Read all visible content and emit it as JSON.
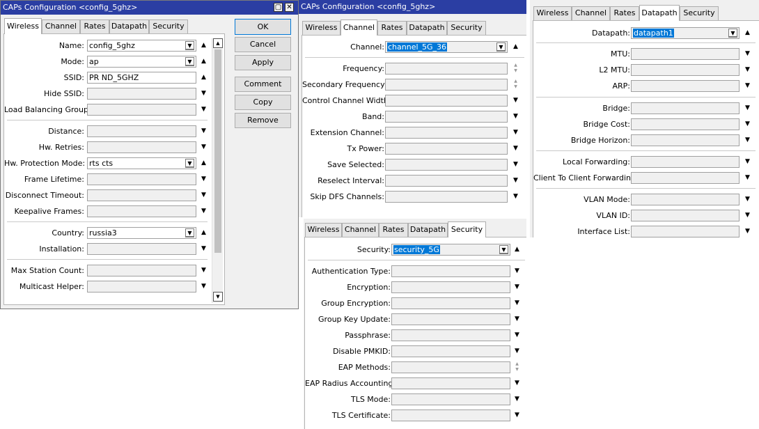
{
  "window1": {
    "title": "CAPs Configuration <config_5ghz>",
    "tabs": [
      "Wireless",
      "Channel",
      "Rates",
      "Datapath",
      "Security"
    ],
    "fields": [
      {
        "label": "Name:",
        "value": "config_5ghz"
      },
      {
        "label": "Mode:",
        "value": "ap"
      },
      {
        "label": "SSID:",
        "value": "PR        ND_5GHZ"
      },
      {
        "label": "Hide SSID:",
        "value": ""
      },
      {
        "label": "Load Balancing Group:",
        "value": ""
      },
      {
        "label": "Distance:",
        "value": ""
      },
      {
        "label": "Hw. Retries:",
        "value": ""
      },
      {
        "label": "Hw. Protection Mode:",
        "value": "rts cts"
      },
      {
        "label": "Frame Lifetime:",
        "value": ""
      },
      {
        "label": "Disconnect Timeout:",
        "value": ""
      },
      {
        "label": "Keepalive Frames:",
        "value": ""
      },
      {
        "label": "Country:",
        "value": "russia3"
      },
      {
        "label": "Installation:",
        "value": ""
      },
      {
        "label": "Max Station Count:",
        "value": ""
      },
      {
        "label": "Multicast Helper:",
        "value": ""
      }
    ],
    "buttons": [
      "OK",
      "Cancel",
      "Apply",
      "Comment",
      "Copy",
      "Remove"
    ]
  },
  "window2": {
    "title": "CAPs Configuration <config_5ghz>",
    "tabs": [
      "Wireless",
      "Channel",
      "Rates",
      "Datapath",
      "Security"
    ],
    "fields": [
      {
        "label": "Channel:",
        "value": "channel_5G_36"
      },
      {
        "label": "Frequency:",
        "value": ""
      },
      {
        "label": "Secondary Frequency:",
        "value": ""
      },
      {
        "label": "Control Channel Width:",
        "value": ""
      },
      {
        "label": "Band:",
        "value": ""
      },
      {
        "label": "Extension Channel:",
        "value": ""
      },
      {
        "label": "Tx Power:",
        "value": ""
      },
      {
        "label": "Save Selected:",
        "value": ""
      },
      {
        "label": "Reselect Interval:",
        "value": ""
      },
      {
        "label": "Skip DFS Channels:",
        "value": ""
      }
    ]
  },
  "window3": {
    "tabs": [
      "Wireless",
      "Channel",
      "Rates",
      "Datapath",
      "Security"
    ],
    "fields": [
      {
        "label": "Datapath:",
        "value": "datapath1"
      },
      {
        "label": "MTU:",
        "value": ""
      },
      {
        "label": "L2 MTU:",
        "value": ""
      },
      {
        "label": "ARP:",
        "value": ""
      },
      {
        "label": "Bridge:",
        "value": ""
      },
      {
        "label": "Bridge Cost:",
        "value": ""
      },
      {
        "label": "Bridge Horizon:",
        "value": ""
      },
      {
        "label": "Local Forwarding:",
        "value": ""
      },
      {
        "label": "Client To Client Forwarding:",
        "value": ""
      },
      {
        "label": "VLAN Mode:",
        "value": ""
      },
      {
        "label": "VLAN ID:",
        "value": ""
      },
      {
        "label": "Interface List:",
        "value": ""
      }
    ]
  },
  "window4": {
    "tabs": [
      "Wireless",
      "Channel",
      "Rates",
      "Datapath",
      "Security"
    ],
    "fields": [
      {
        "label": "Security:",
        "value": "security_5G"
      },
      {
        "label": "Authentication Type:",
        "value": ""
      },
      {
        "label": "Encryption:",
        "value": ""
      },
      {
        "label": "Group Encryption:",
        "value": ""
      },
      {
        "label": "Group Key Update:",
        "value": ""
      },
      {
        "label": "Passphrase:",
        "value": ""
      },
      {
        "label": "Disable PMKID:",
        "value": ""
      },
      {
        "label": "EAP Methods:",
        "value": ""
      },
      {
        "label": "EAP Radius Accounting:",
        "value": ""
      },
      {
        "label": "TLS Mode:",
        "value": ""
      },
      {
        "label": "TLS Certificate:",
        "value": ""
      }
    ]
  },
  "colors": {
    "titlebar": "#2b3ea3",
    "selection": "#0078d7",
    "panel": "#f0f0f0"
  }
}
